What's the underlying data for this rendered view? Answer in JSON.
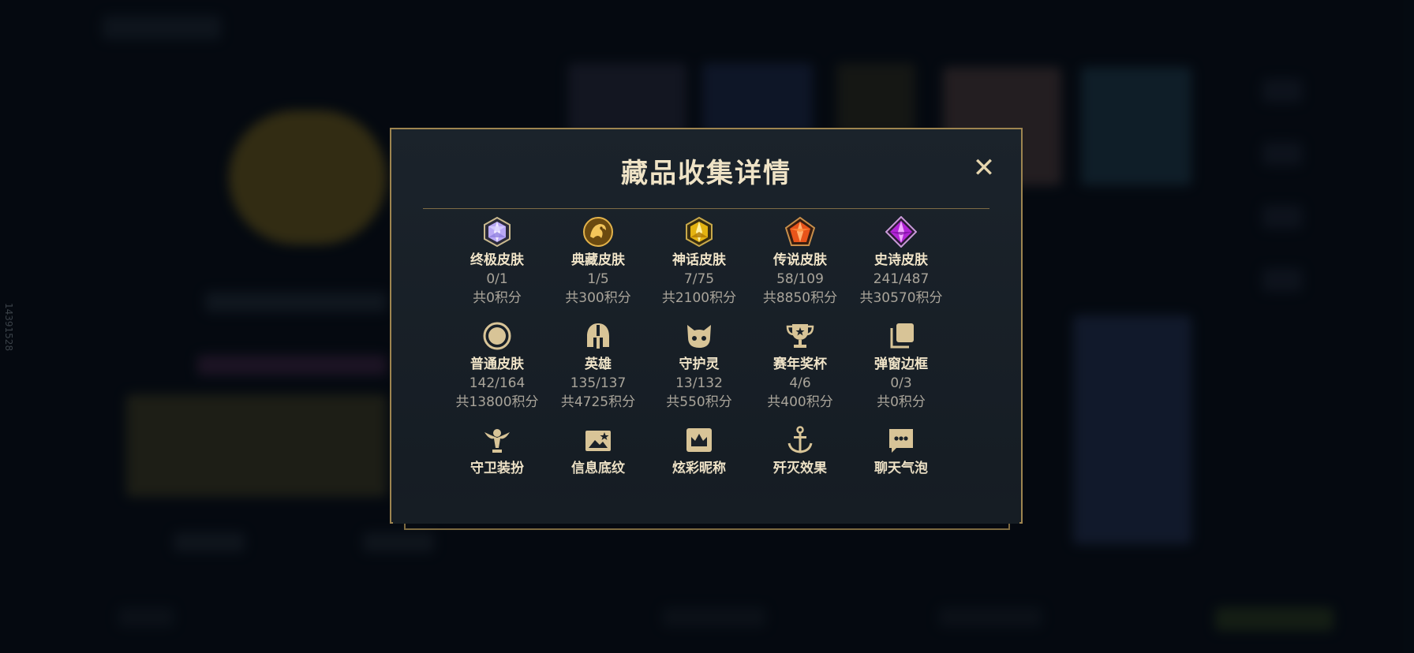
{
  "side_id": "14391528",
  "dialog": {
    "title": "藏品收集详情",
    "close_glyph": "✕"
  },
  "items": [
    {
      "name": "终极皮肤",
      "count": "0/1",
      "points": "共0积分",
      "icon": "ultimate-gem-icon"
    },
    {
      "name": "典藏皮肤",
      "count": "1/5",
      "points": "共300积分",
      "icon": "exalted-dragon-icon"
    },
    {
      "name": "神话皮肤",
      "count": "7/75",
      "points": "共2100积分",
      "icon": "mythic-gem-icon"
    },
    {
      "name": "传说皮肤",
      "count": "58/109",
      "points": "共8850积分",
      "icon": "legendary-gem-icon"
    },
    {
      "name": "史诗皮肤",
      "count": "241/487",
      "points": "共30570积分",
      "icon": "epic-gem-icon"
    },
    {
      "name": "普通皮肤",
      "count": "142/164",
      "points": "共13800积分",
      "icon": "standard-circle-icon"
    },
    {
      "name": "英雄",
      "count": "135/137",
      "points": "共4725积分",
      "icon": "helmet-icon"
    },
    {
      "name": "守护灵",
      "count": "13/132",
      "points": "共550积分",
      "icon": "little-legend-icon"
    },
    {
      "name": "赛年奖杯",
      "count": "4/6",
      "points": "共400积分",
      "icon": "trophy-icon"
    },
    {
      "name": "弹窗边框",
      "count": "0/3",
      "points": "共0积分",
      "icon": "frames-icon"
    },
    {
      "name": "守卫装扮",
      "count": "",
      "points": "",
      "icon": "ward-icon"
    },
    {
      "name": "信息底纹",
      "count": "",
      "points": "",
      "icon": "banner-icon"
    },
    {
      "name": "炫彩昵称",
      "count": "",
      "points": "",
      "icon": "crown-card-icon"
    },
    {
      "name": "歼灭效果",
      "count": "",
      "points": "",
      "icon": "anchor-icon"
    },
    {
      "name": "聊天气泡",
      "count": "",
      "points": "",
      "icon": "chat-bubble-icon"
    }
  ],
  "colors": {
    "accent_gold": "#9e8550",
    "title": "#efe3c6",
    "muted": "#a9a49a",
    "icon_gold": "#d8c497"
  }
}
